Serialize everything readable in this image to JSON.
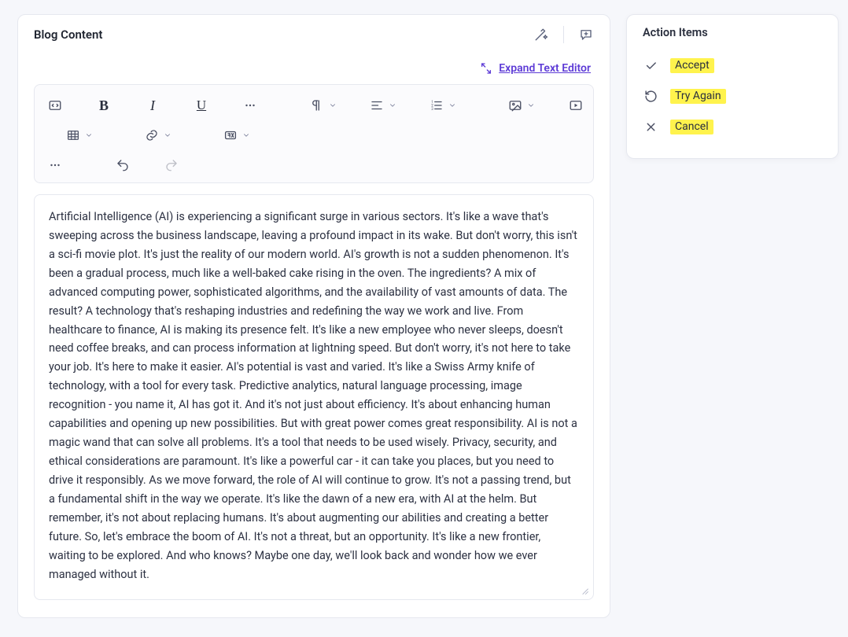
{
  "header": {
    "title": "Blog Content",
    "expand_label": "Expand Text Editor"
  },
  "content": {
    "body": "Artificial Intelligence (AI) is experiencing a significant surge in various sectors. It's like a wave that's sweeping across the business landscape, leaving a profound impact in its wake. But don't worry, this isn't a sci-fi movie plot. It's just the reality of our modern world. AI's growth is not a sudden phenomenon. It's been a gradual process, much like a well-baked cake rising in the oven. The ingredients? A mix of advanced computing power, sophisticated algorithms, and the availability of vast amounts of data. The result? A technology that's reshaping industries and redefining the way we work and live. From healthcare to finance, AI is making its presence felt. It's like a new employee who never sleeps, doesn't need coffee breaks, and can process information at lightning speed. But don't worry, it's not here to take your job. It's here to make it easier. AI's potential is vast and varied. It's like a Swiss Army knife of technology, with a tool for every task. Predictive analytics, natural language processing, image recognition - you name it, AI has got it. And it's not just about efficiency. It's about enhancing human capabilities and opening up new possibilities. But with great power comes great responsibility. AI is not a magic wand that can solve all problems. It's a tool that needs to be used wisely. Privacy, security, and ethical considerations are paramount. It's like a powerful car - it can take you places, but you need to drive it responsibly. As we move forward, the role of AI will continue to grow. It's not a passing trend, but a fundamental shift in the way we operate. It's like the dawn of a new era, with AI at the helm. But remember, it's not about replacing humans. It's about augmenting our abilities and creating a better future. So, let's embrace the boom of AI. It's not a threat, but an opportunity. It's like a new frontier, waiting to be explored. And who knows? Maybe one day, we'll look back and wonder how we ever managed without it."
  },
  "actions": {
    "title": "Action Items",
    "accept": "Accept",
    "try_again": "Try Again",
    "cancel": "Cancel"
  }
}
